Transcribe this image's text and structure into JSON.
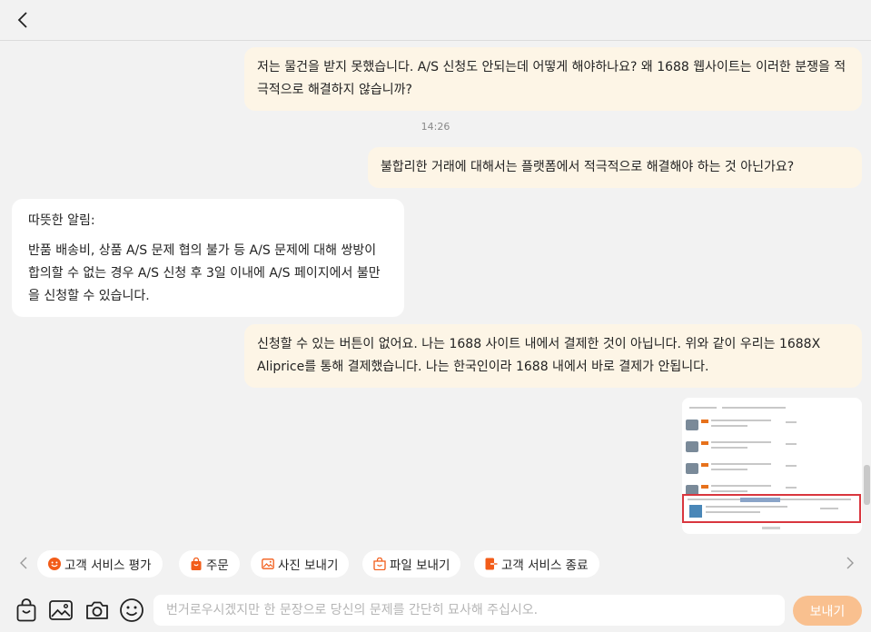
{
  "messages": [
    {
      "sender": "me",
      "text": "저는 물건을 받지 못했습니다. A/S 신청도 안되는데 어떻게 해야하나요? 왜 1688 웹사이트는 이러한 분쟁을 적극적으로 해결하지 않습니까?"
    },
    {
      "type": "time",
      "text": "14:26"
    },
    {
      "sender": "me",
      "text": "불합리한 거래에 대해서는 플랫폼에서 적극적으로 해결해야 하는 것 아닌가요?"
    },
    {
      "sender": "service",
      "title": "따뜻한 알림:",
      "text": "반품 배송비, 상품 A/S 문제 협의 불가 등 A/S 문제에 대해 쌍방이 합의할 수 없는 경우 A/S 신청 후 3일 이내에 A/S 페이지에서 불만을 신청할 수 있습니다."
    },
    {
      "sender": "me",
      "text": "신청할 수 있는 버튼이 없어요. 나는 1688 사이트 내에서 결제한 것이 아닙니다. 위와 같이 우리는 1688X Aliprice를 통해 결제했습니다. 나는 한국인이라 1688 내에서 바로 결제가 안됩니다."
    },
    {
      "sender": "me",
      "type": "image",
      "alt": "order-list-screenshot"
    }
  ],
  "quick_actions": [
    {
      "icon": "smile-icon",
      "label": "고객 서비스 평가"
    },
    {
      "icon": "shopping-bag-icon",
      "label": "주문"
    },
    {
      "icon": "image-icon",
      "label": "사진 보내기"
    },
    {
      "icon": "folder-icon",
      "label": "파일 보내기"
    },
    {
      "icon": "exit-icon",
      "label": "고객 서비스 종료"
    }
  ],
  "composer": {
    "placeholder": "번거로우시겠지만 한 문장으로 당신의 문제를 간단히 묘사해 주십시오.",
    "send_label": "보내기",
    "tools": [
      "bag-icon",
      "image-icon",
      "camera-icon",
      "emoji-icon"
    ]
  },
  "colors": {
    "accent": "#f25c19",
    "my_bubble": "#fdf5e6",
    "send_button": "#f9c08f"
  }
}
